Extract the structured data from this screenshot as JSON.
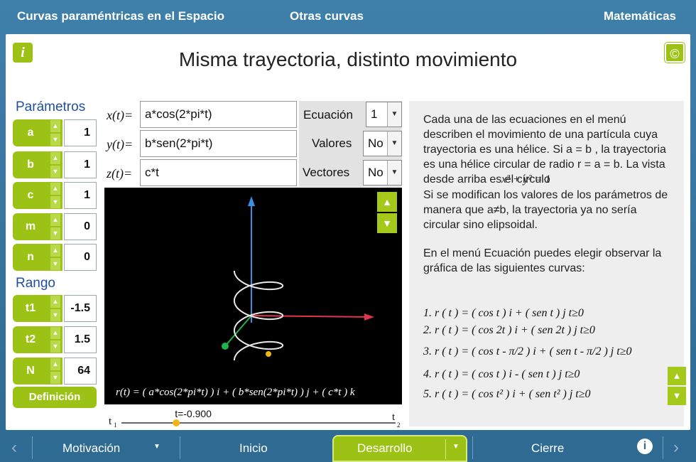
{
  "header": {
    "left": "Curvas paraméntricas en el Espacio",
    "middle": "Otras curvas",
    "right": "Matemáticas"
  },
  "title": "Misma trayectoria, distinto movimiento",
  "info_label": "i",
  "copy_label": "©",
  "params_title": "Parámetros",
  "params": [
    {
      "name": "a",
      "value": "1"
    },
    {
      "name": "b",
      "value": "1"
    },
    {
      "name": "c",
      "value": "1"
    },
    {
      "name": "m",
      "value": "0"
    },
    {
      "name": "n",
      "value": "0"
    }
  ],
  "range_title": "Rango",
  "range": [
    {
      "name": "t1",
      "value": "-1.5"
    },
    {
      "name": "t2",
      "value": "1.5"
    },
    {
      "name": "N",
      "value": "64"
    }
  ],
  "definition_button": "Definición",
  "equations": [
    {
      "label": "x(t)=",
      "value": "a*cos(2*pi*t)"
    },
    {
      "label": "y(t)=",
      "value": "b*sen(2*pi*t)"
    },
    {
      "label": "z(t)=",
      "value": "c*t"
    }
  ],
  "options": {
    "ecuacion": {
      "label": "Ecuación",
      "value": "1"
    },
    "valores": {
      "label": "Valores",
      "value": "No"
    },
    "vectores": {
      "label": "Vectores",
      "value": "No"
    }
  },
  "graph": {
    "rt_equation": "r(t) = ( a*cos(2*pi*t) ) i + ( b*sen(2*pi*t) ) j + ( c*t ) k"
  },
  "slider": {
    "t_label": "t=-0.900",
    "left_label": "t",
    "left_sub": "1",
    "right_label": "t",
    "right_sub": "2",
    "value": -0.9,
    "min": -1.5,
    "max": 1.5
  },
  "explanation": {
    "p1": "Cada una de las ecuaciones en el menú describen el movimiento de una partícula cuya trayectoria es una hélice. Si a = b , la trayectoria es una hélice circular de radio r = a = b. La vista desde arriba es el círculo",
    "circle_eq": "x² + y² = 1",
    "p2": "Si se modifican los valores de los parámetros de manera que a≠b, la trayectoria ya no sería circular sino elipsoidal.",
    "p3": "En el menú Ecuación puedes elegir observar la gráfica de las siguientes curvas:",
    "curves": [
      "1.  r ( t ) = ( cos t )  i  + ( sen t )  j  t≥0",
      "2.  r ( t ) = ( cos 2t )  i  + ( sen 2t )  j  t≥0",
      "3.  r ( t ) = ( cos t - π/2 )  i  + ( sen t - π/2 )  j  t≥0",
      "4.  r ( t ) = ( cos t )  i  - ( sen t )  j  t≥0",
      "5.  r ( t ) = ( cos t² )  i  + ( sen t² )  j  t≥0"
    ]
  },
  "nav": {
    "motivacion": "Motivación",
    "inicio": "Inicio",
    "desarrollo": "Desarrollo",
    "cierre": "Cierre"
  }
}
